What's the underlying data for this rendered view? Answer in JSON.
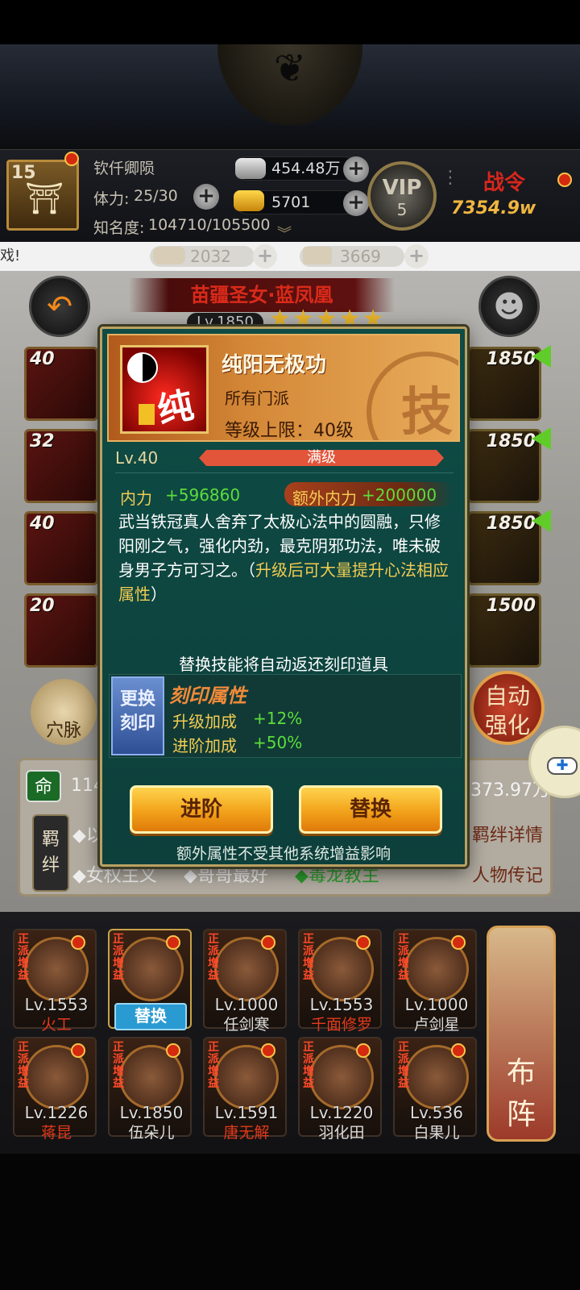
{
  "player": {
    "level": "15",
    "name": "钦仟卿陨",
    "stamina_label": "体力:",
    "stamina": "25/30",
    "fame_label": "知名度:",
    "fame": "104710/105500",
    "silver": "454.48万",
    "gold": "5701",
    "vip_label": "VIP",
    "vip_level": "5",
    "power_label": "战令",
    "power_value": "7354.9w"
  },
  "notice": {
    "text": "戏!",
    "item1": "2032",
    "item2": "3669"
  },
  "hero": {
    "title": "苗疆圣女·蓝凤凰",
    "level": "Lv.1850",
    "left_slots": [
      "40",
      "32",
      "40",
      "20"
    ],
    "right_slots": [
      "1850",
      "1850",
      "1850",
      "1500"
    ],
    "acupoint_label": "穴脉",
    "auto_label_1": "自动",
    "auto_label_2": "强化",
    "fate_icon": "命",
    "fate_value": "114",
    "power_right": "373.97万",
    "bond_label": "羁绊",
    "tags": [
      "◆以",
      "◆女权主义",
      "◆哥哥最好",
      "◆毒龙教主"
    ],
    "bond_detail": "羁绊详情",
    "biography": "人物传记"
  },
  "dialog": {
    "skill_name": "纯阳无极功",
    "faction": "所有门派",
    "level_cap": "等级上限：40级",
    "seal_char": "技",
    "icon_char": "纯",
    "level": "Lv.40",
    "level_bar_label": "满级",
    "stat_name": "内力",
    "stat_value": "+596860",
    "extra_name": "额外内力",
    "extra_value": "+200000",
    "desc_main": "武当铁冠真人舍弃了太极心法中的圆融，只修阳刚之气，强化内劲，最克阴邪功法，唯未破身男子方可习之。（",
    "desc_highlight": "升级后可大量提升心法相应属性",
    "desc_tail": "）",
    "replace_notice": "替换技能将自动返还刻印道具",
    "engrave_button": "更换刻印",
    "engrave_title": "刻印属性",
    "engrave_line1_label": "升级加成",
    "engrave_line1_value": "+12%",
    "engrave_line2_label": "进阶加成",
    "engrave_line2_value": "+50%",
    "advance_button": "进阶",
    "replace_button": "替换",
    "footer_note": "额外属性不受其他系统增益影响"
  },
  "lineup": {
    "tag": "正派增益",
    "replace_label": "替换",
    "formation_label_1": "布",
    "formation_label_2": "阵",
    "heroes": [
      {
        "level": "Lv.1553",
        "name": "火工",
        "color": "#e23a1c"
      },
      {
        "level": "",
        "name": "",
        "color": "#ffffff"
      },
      {
        "level": "Lv.1000",
        "name": "任剑寒",
        "color": "#dddddd"
      },
      {
        "level": "Lv.1553",
        "name": "千面修罗",
        "color": "#e23a1c"
      },
      {
        "level": "Lv.1000",
        "name": "卢剑星",
        "color": "#dddddd"
      },
      {
        "level": "Lv.1226",
        "name": "蒋昆",
        "color": "#e23a1c"
      },
      {
        "level": "Lv.1850",
        "name": "伍朵儿",
        "color": "#dddddd"
      },
      {
        "level": "Lv.1591",
        "name": "唐无解",
        "color": "#e23a1c"
      },
      {
        "level": "Lv.1220",
        "name": "羽化田",
        "color": "#dddddd"
      },
      {
        "level": "Lv.536",
        "name": "白果儿",
        "color": "#dddddd"
      }
    ]
  }
}
